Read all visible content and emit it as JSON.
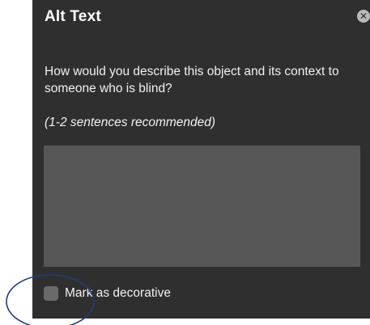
{
  "dialog": {
    "title": "Alt Text",
    "close_icon": "close-circle-icon",
    "question": "How would you describe this object and its context to someone who is blind?",
    "hint": "(1-2 sentences recommended)",
    "description_value": "",
    "decorative_label": "Mark as decorative",
    "decorative_checked": false
  },
  "colors": {
    "panel_bg": "#2f2f2f",
    "textbox_bg": "#575757",
    "annotation_circle": "#1f3d7a"
  }
}
